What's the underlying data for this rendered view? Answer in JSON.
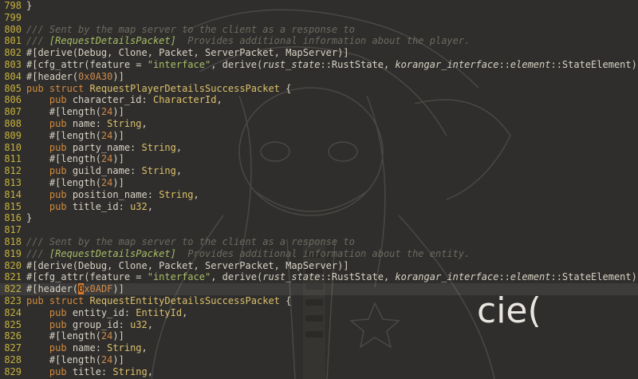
{
  "editor": {
    "lines": [
      {
        "n": "798",
        "t": [
          [
            "}",
            "p"
          ]
        ]
      },
      {
        "n": "799",
        "t": []
      },
      {
        "n": "800",
        "t": [
          [
            "/// Sent by the map server to the client as a response to",
            "cm"
          ]
        ]
      },
      {
        "n": "801",
        "t": [
          [
            "/// ",
            "cm"
          ],
          [
            "[RequestDetailsPacket]",
            "cmk"
          ],
          [
            "  Provides additional information about the player.",
            "cm"
          ]
        ]
      },
      {
        "n": "802",
        "t": [
          [
            "#[derive(Debug, Clone, Packet, ServerPacket, MapServer)]",
            "p"
          ]
        ]
      },
      {
        "n": "803",
        "t": [
          [
            "#[cfg_attr(feature = ",
            "p"
          ],
          [
            "\"interface\"",
            "str"
          ],
          [
            ", derive(",
            "p"
          ],
          [
            "rust_state",
            "it"
          ],
          [
            "::RustState, ",
            "p"
          ],
          [
            "korangar_interface",
            "it"
          ],
          [
            "::",
            "p"
          ],
          [
            "element",
            "it"
          ],
          [
            "::StateElement))]",
            "p"
          ]
        ]
      },
      {
        "n": "804",
        "t": [
          [
            "#[header(",
            "p"
          ],
          [
            "0x0A30",
            "num"
          ],
          [
            ")]",
            "p"
          ]
        ]
      },
      {
        "n": "805",
        "t": [
          [
            "pub struct ",
            "kw"
          ],
          [
            "RequestPlayerDetailsSuccessPacket",
            "ty"
          ],
          [
            " {",
            "p"
          ]
        ]
      },
      {
        "n": "806",
        "t": [
          [
            "    ",
            "p"
          ],
          [
            "pub ",
            "kw"
          ],
          [
            "character_id: ",
            "p"
          ],
          [
            "CharacterId",
            "ty"
          ],
          [
            ",",
            "p"
          ]
        ]
      },
      {
        "n": "807",
        "t": [
          [
            "    #[length(",
            "p"
          ],
          [
            "24",
            "num"
          ],
          [
            ")]",
            "p"
          ]
        ]
      },
      {
        "n": "808",
        "t": [
          [
            "    ",
            "p"
          ],
          [
            "pub ",
            "kw"
          ],
          [
            "name: ",
            "p"
          ],
          [
            "String",
            "ty"
          ],
          [
            ",",
            "p"
          ]
        ]
      },
      {
        "n": "809",
        "t": [
          [
            "    #[length(",
            "p"
          ],
          [
            "24",
            "num"
          ],
          [
            ")]",
            "p"
          ]
        ]
      },
      {
        "n": "810",
        "t": [
          [
            "    ",
            "p"
          ],
          [
            "pub ",
            "kw"
          ],
          [
            "party_name: ",
            "p"
          ],
          [
            "String",
            "ty"
          ],
          [
            ",",
            "p"
          ]
        ]
      },
      {
        "n": "811",
        "t": [
          [
            "    #[length(",
            "p"
          ],
          [
            "24",
            "num"
          ],
          [
            ")]",
            "p"
          ]
        ]
      },
      {
        "n": "812",
        "t": [
          [
            "    ",
            "p"
          ],
          [
            "pub ",
            "kw"
          ],
          [
            "guild_name: ",
            "p"
          ],
          [
            "String",
            "ty"
          ],
          [
            ",",
            "p"
          ]
        ]
      },
      {
        "n": "813",
        "t": [
          [
            "    #[length(",
            "p"
          ],
          [
            "24",
            "num"
          ],
          [
            ")]",
            "p"
          ]
        ]
      },
      {
        "n": "814",
        "t": [
          [
            "    ",
            "p"
          ],
          [
            "pub ",
            "kw"
          ],
          [
            "position_name: ",
            "p"
          ],
          [
            "String",
            "ty"
          ],
          [
            ",",
            "p"
          ]
        ]
      },
      {
        "n": "815",
        "t": [
          [
            "    ",
            "p"
          ],
          [
            "pub ",
            "kw"
          ],
          [
            "title_id: ",
            "p"
          ],
          [
            "u32",
            "ty"
          ],
          [
            ",",
            "p"
          ]
        ]
      },
      {
        "n": "816",
        "t": [
          [
            "}",
            "p"
          ]
        ]
      },
      {
        "n": "817",
        "t": []
      },
      {
        "n": "818",
        "t": [
          [
            "/// Sent by the map server to the client as a response to",
            "cm"
          ]
        ]
      },
      {
        "n": "819",
        "t": [
          [
            "/// ",
            "cm"
          ],
          [
            "[RequestDetailsPacket]",
            "cmk"
          ],
          [
            "  Provides additional information about the entity.",
            "cm"
          ]
        ]
      },
      {
        "n": "820",
        "t": [
          [
            "#[derive(Debug, Clone, Packet, ServerPacket, MapServer)]",
            "p"
          ]
        ]
      },
      {
        "n": "821",
        "t": [
          [
            "#[cfg_attr(feature = ",
            "p"
          ],
          [
            "\"interface\"",
            "str"
          ],
          [
            ", derive(",
            "p"
          ],
          [
            "rust_state",
            "it"
          ],
          [
            "::RustState, ",
            "p"
          ],
          [
            "korangar_interface",
            "it"
          ],
          [
            "::",
            "p"
          ],
          [
            "element",
            "it"
          ],
          [
            "::StateElement))]",
            "p"
          ]
        ]
      },
      {
        "n": "822",
        "cur": true,
        "t": [
          [
            "#[header(",
            "p"
          ],
          [
            "0",
            "cursor"
          ],
          [
            "x0ADF",
            "num"
          ],
          [
            ")]",
            "p"
          ]
        ]
      },
      {
        "n": "823",
        "t": [
          [
            "pub struct ",
            "kw"
          ],
          [
            "RequestEntityDetailsSuccessPacket",
            "ty"
          ],
          [
            " {",
            "p"
          ]
        ]
      },
      {
        "n": "824",
        "t": [
          [
            "    ",
            "p"
          ],
          [
            "pub ",
            "kw"
          ],
          [
            "entity_id: ",
            "p"
          ],
          [
            "EntityId",
            "ty"
          ],
          [
            ",",
            "p"
          ]
        ]
      },
      {
        "n": "825",
        "t": [
          [
            "    ",
            "p"
          ],
          [
            "pub ",
            "kw"
          ],
          [
            "group_id: ",
            "p"
          ],
          [
            "u32",
            "ty"
          ],
          [
            ",",
            "p"
          ]
        ]
      },
      {
        "n": "826",
        "t": [
          [
            "    #[length(",
            "p"
          ],
          [
            "24",
            "num"
          ],
          [
            ")]",
            "p"
          ]
        ]
      },
      {
        "n": "827",
        "t": [
          [
            "    ",
            "p"
          ],
          [
            "pub ",
            "kw"
          ],
          [
            "name: ",
            "p"
          ],
          [
            "String",
            "ty"
          ],
          [
            ",",
            "p"
          ]
        ]
      },
      {
        "n": "828",
        "t": [
          [
            "    #[length(",
            "p"
          ],
          [
            "24",
            "num"
          ],
          [
            ")]",
            "p"
          ]
        ]
      },
      {
        "n": "829",
        "t": [
          [
            "    ",
            "p"
          ],
          [
            "pub ",
            "kw"
          ],
          [
            "title: ",
            "p"
          ],
          [
            "String",
            "ty"
          ],
          [
            ",",
            "p"
          ]
        ]
      }
    ]
  },
  "overlay": {
    "typed_text": "cie("
  }
}
